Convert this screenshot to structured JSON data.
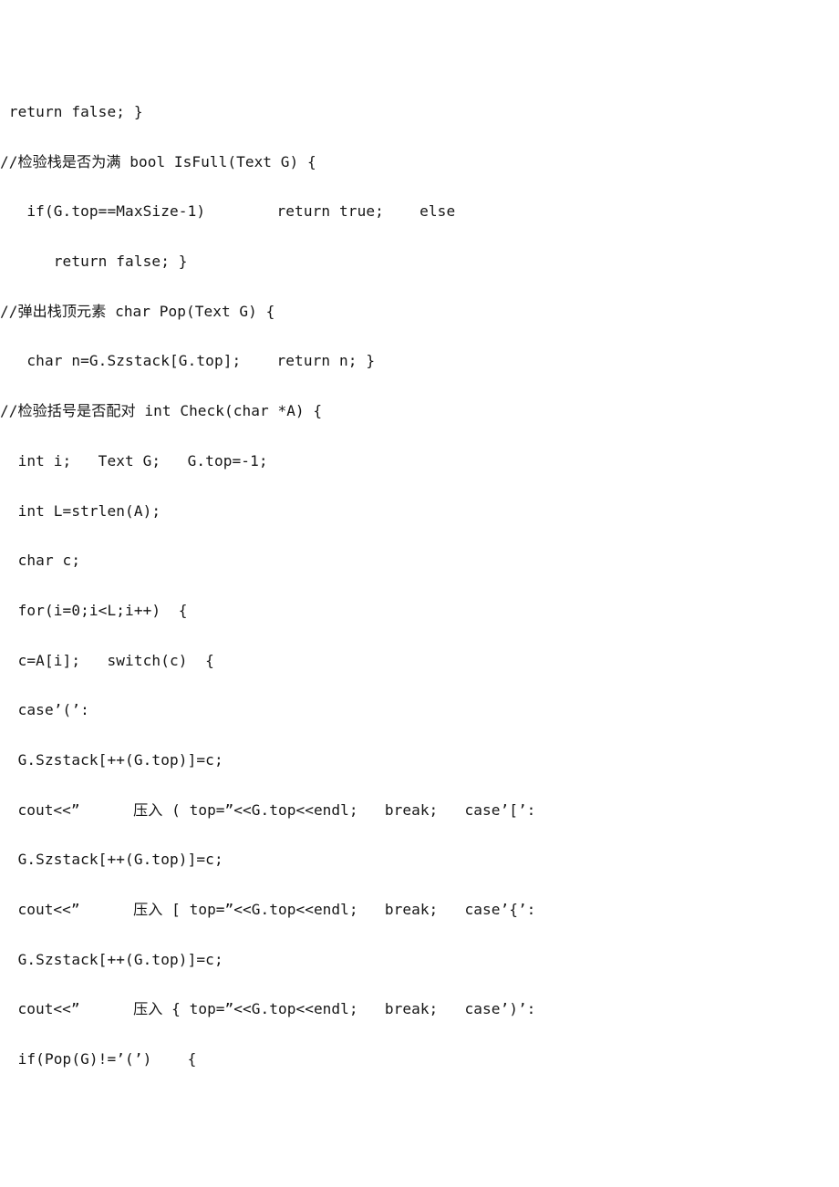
{
  "document": {
    "type": "source-code-listing",
    "language": "C++",
    "background_color": "#ffffff",
    "text_color": "#161616",
    "lines": [
      {
        "id": "line-01",
        "indent": 1,
        "text": " return false; }"
      },
      {
        "id": "line-02",
        "indent": 0,
        "text": "//检验栈是否为满 bool IsFull(Text G) {"
      },
      {
        "id": "line-03",
        "indent": 2,
        "text": "   if(G.top==MaxSize-1)        return true;    else"
      },
      {
        "id": "line-04",
        "indent": 3,
        "text": "      return false; }"
      },
      {
        "id": "line-05",
        "indent": 0,
        "text": "//弹出栈顶元素 char Pop(Text G) {"
      },
      {
        "id": "line-06",
        "indent": 2,
        "text": "   char n=G.Szstack[G.top];    return n; }"
      },
      {
        "id": "line-07",
        "indent": 0,
        "text": "//检验括号是否配对 int Check(char *A) {"
      },
      {
        "id": "line-08",
        "indent": 1,
        "text": "  int i;   Text G;   G.top=-1;"
      },
      {
        "id": "line-09",
        "indent": 1,
        "text": "  int L=strlen(A);"
      },
      {
        "id": "line-10",
        "indent": 1,
        "text": "  char c;"
      },
      {
        "id": "line-11",
        "indent": 1,
        "text": "  for(i=0;i<L;i++)  {"
      },
      {
        "id": "line-12",
        "indent": 1,
        "text": "  c=A[i];   switch(c)  {"
      },
      {
        "id": "line-13",
        "indent": 1,
        "text": "  case’(’:"
      },
      {
        "id": "line-14",
        "indent": 1,
        "text": "  G.Szstack[++(G.top)]=c;"
      },
      {
        "id": "line-15",
        "indent": 1,
        "text": "  cout<<”      压入 ( top=”<<G.top<<endl;   break;   case’[’:"
      },
      {
        "id": "line-16",
        "indent": 1,
        "text": "  G.Szstack[++(G.top)]=c;"
      },
      {
        "id": "line-17",
        "indent": 1,
        "text": "  cout<<”      压入 [ top=”<<G.top<<endl;   break;   case’{’:"
      },
      {
        "id": "line-18",
        "indent": 1,
        "text": "  G.Szstack[++(G.top)]=c;"
      },
      {
        "id": "line-19",
        "indent": 1,
        "text": "  cout<<”      压入 { top=”<<G.top<<endl;   break;   case’)’:"
      },
      {
        "id": "line-20",
        "indent": 1,
        "text": "  if(Pop(G)!=’(’)    {"
      }
    ]
  }
}
